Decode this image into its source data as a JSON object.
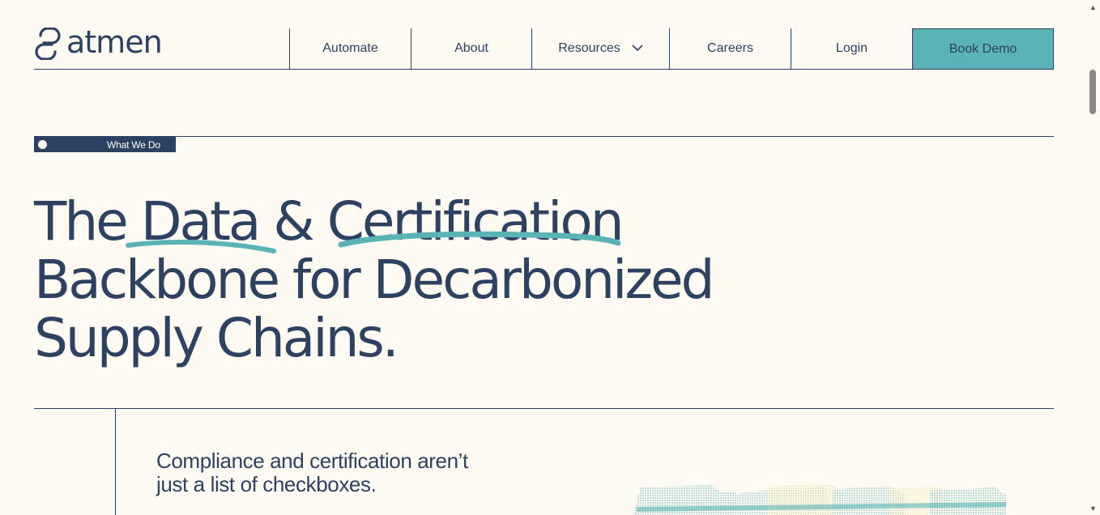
{
  "brand": {
    "name": "atmen"
  },
  "nav": {
    "items": [
      {
        "label": "Automate"
      },
      {
        "label": "About"
      },
      {
        "label": "Resources"
      },
      {
        "label": "Careers"
      },
      {
        "label": "Login"
      }
    ],
    "cta_label": "Book Demo"
  },
  "section": {
    "tag": "What We Do"
  },
  "hero": {
    "line1_part1": "The ",
    "line1_word1": "Data",
    "line1_part2": " & ",
    "line1_word2": "Certification",
    "line2": "Backbone for Decarbonized",
    "line3": "Supply Chains."
  },
  "intro": {
    "line1": "Compliance and certification aren’t",
    "line2": "just a list of checkboxes."
  },
  "colors": {
    "ink": "#2d4163",
    "accent": "#5ab4b5",
    "background": "#fefbf3",
    "highlight_yellow": "#f2e7a8"
  },
  "icons": {
    "logo": "link-chain-icon",
    "resources_dropdown": "chevron-down-icon",
    "scroll_up": "triangle-up-icon",
    "scroll_down": "triangle-down-icon"
  }
}
